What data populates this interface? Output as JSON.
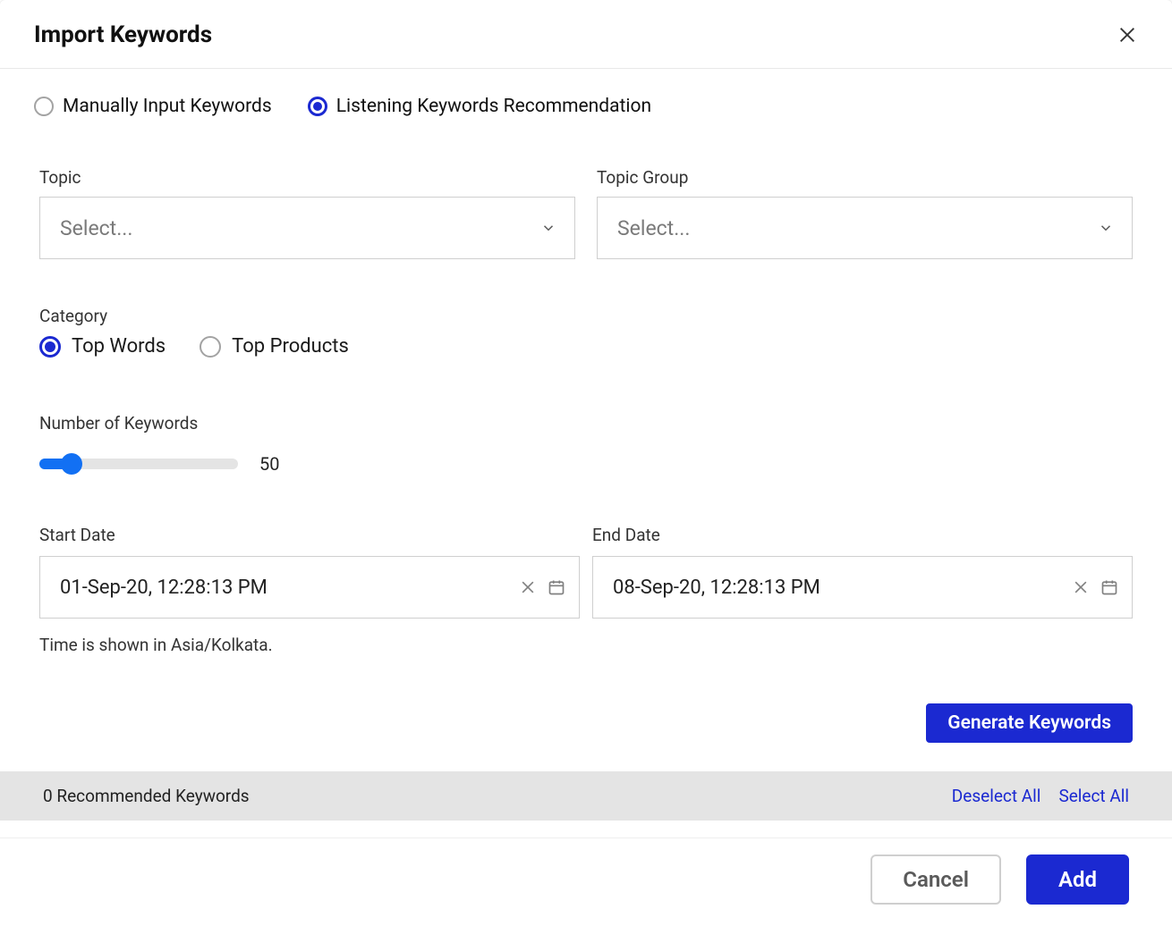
{
  "header": {
    "title": "Import Keywords"
  },
  "mode": {
    "manual_label": "Manually Input Keywords",
    "listening_label": "Listening Keywords Recommendation",
    "selected": "listening"
  },
  "topic": {
    "label": "Topic",
    "placeholder": "Select..."
  },
  "topic_group": {
    "label": "Topic Group",
    "placeholder": "Select..."
  },
  "category": {
    "label": "Category",
    "options": {
      "top_words": "Top Words",
      "top_products": "Top Products"
    },
    "selected": "top_words"
  },
  "keywords_count": {
    "label": "Number of Keywords",
    "value": "50"
  },
  "start_date": {
    "label": "Start Date",
    "value": "01-Sep-20, 12:28:13 PM"
  },
  "end_date": {
    "label": "End Date",
    "value": "08-Sep-20, 12:28:13 PM"
  },
  "timezone_note": "Time is shown in Asia/Kolkata.",
  "buttons": {
    "generate": "Generate Keywords",
    "cancel": "Cancel",
    "add": "Add"
  },
  "recommended": {
    "count_label": "0 Recommended Keywords",
    "deselect_all": "Deselect All",
    "select_all": "Select All"
  }
}
